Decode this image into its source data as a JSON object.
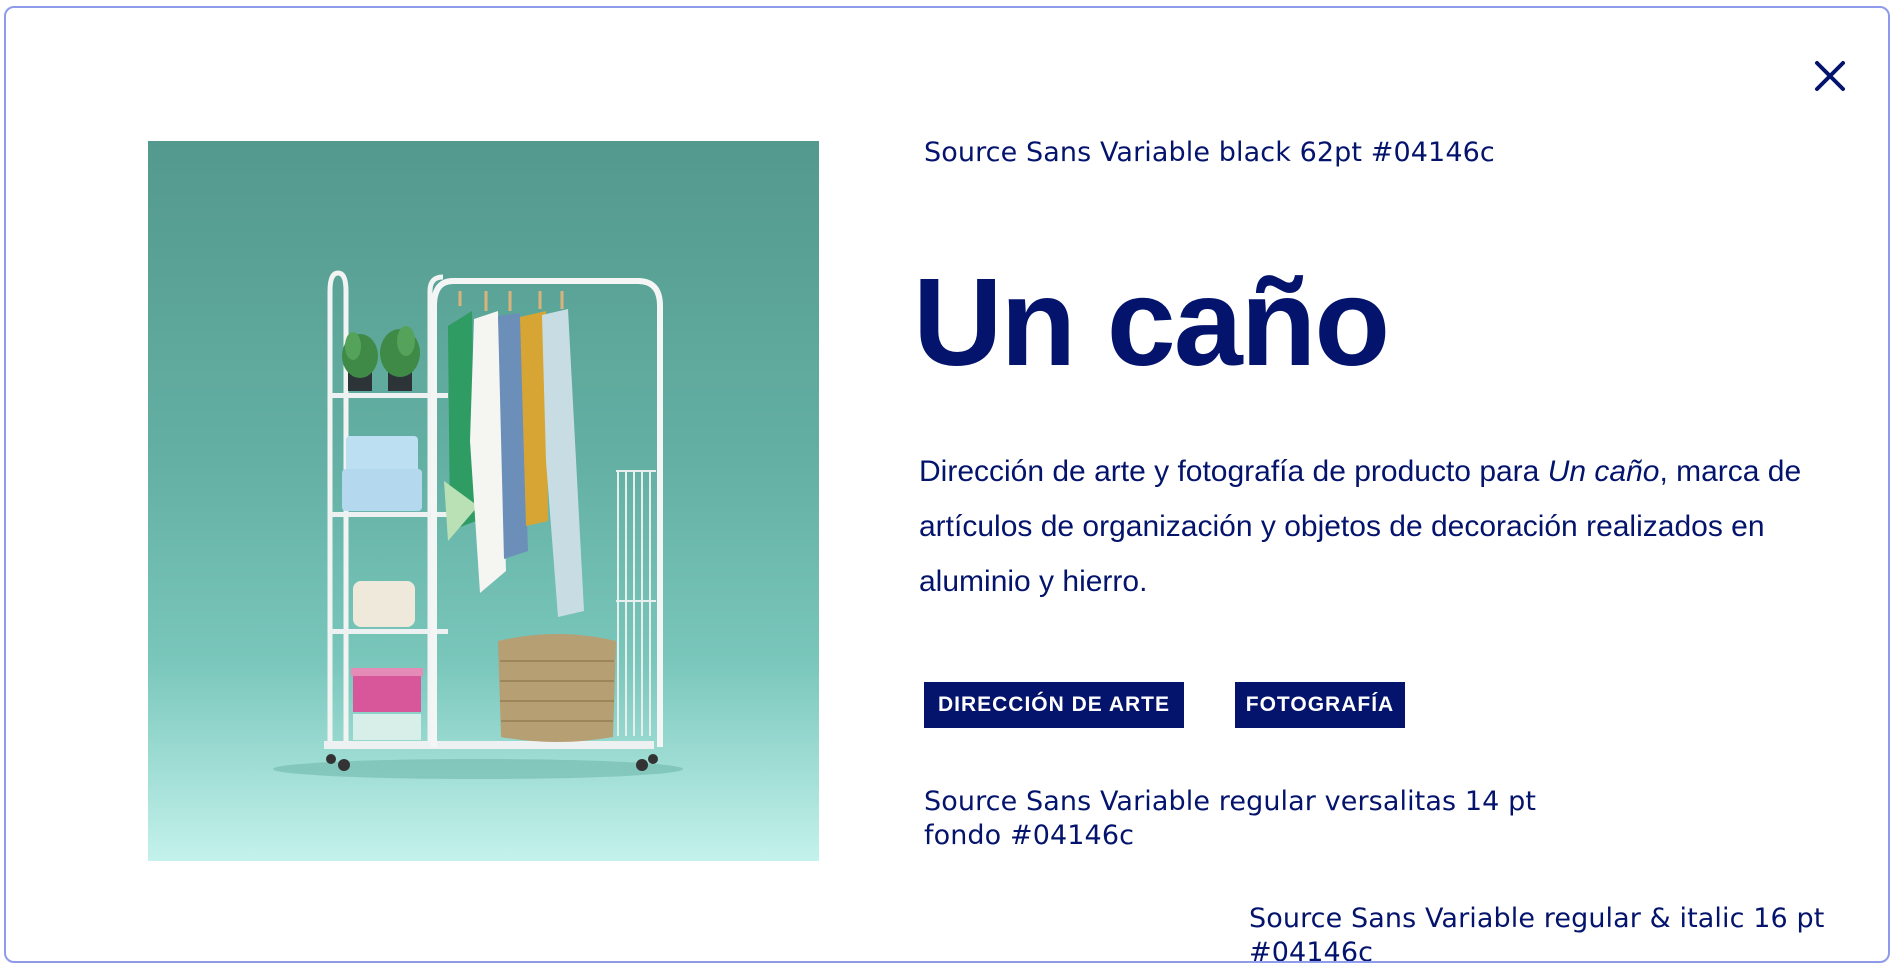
{
  "close": {
    "icon": "close-icon"
  },
  "project": {
    "title": "Un caño",
    "description_part1": "Dirección de arte y fotografía de producto para ",
    "description_italic": "Un caño",
    "description_part2": ", marca de artículos de organización y objetos de decoración realizados en aluminio y hierro.",
    "tags": [
      "DIRECCIÓN DE ARTE",
      "FOTOGRAFÍA"
    ]
  },
  "annotations": {
    "title_spec": "Source Sans Variable black 62pt #04146c",
    "tags_spec_line1": "Source Sans Variable regular versalitas 14 pt",
    "tags_spec_line2": "fondo #04146c",
    "body_spec_line1": "Source Sans Variable regular & italic 16 pt",
    "body_spec_line2": "#04146c"
  },
  "colors": {
    "brand": "#04146c",
    "frame_border": "#8e9bea",
    "photo_top": "#54998d",
    "photo_bottom": "#c4f2ec"
  }
}
